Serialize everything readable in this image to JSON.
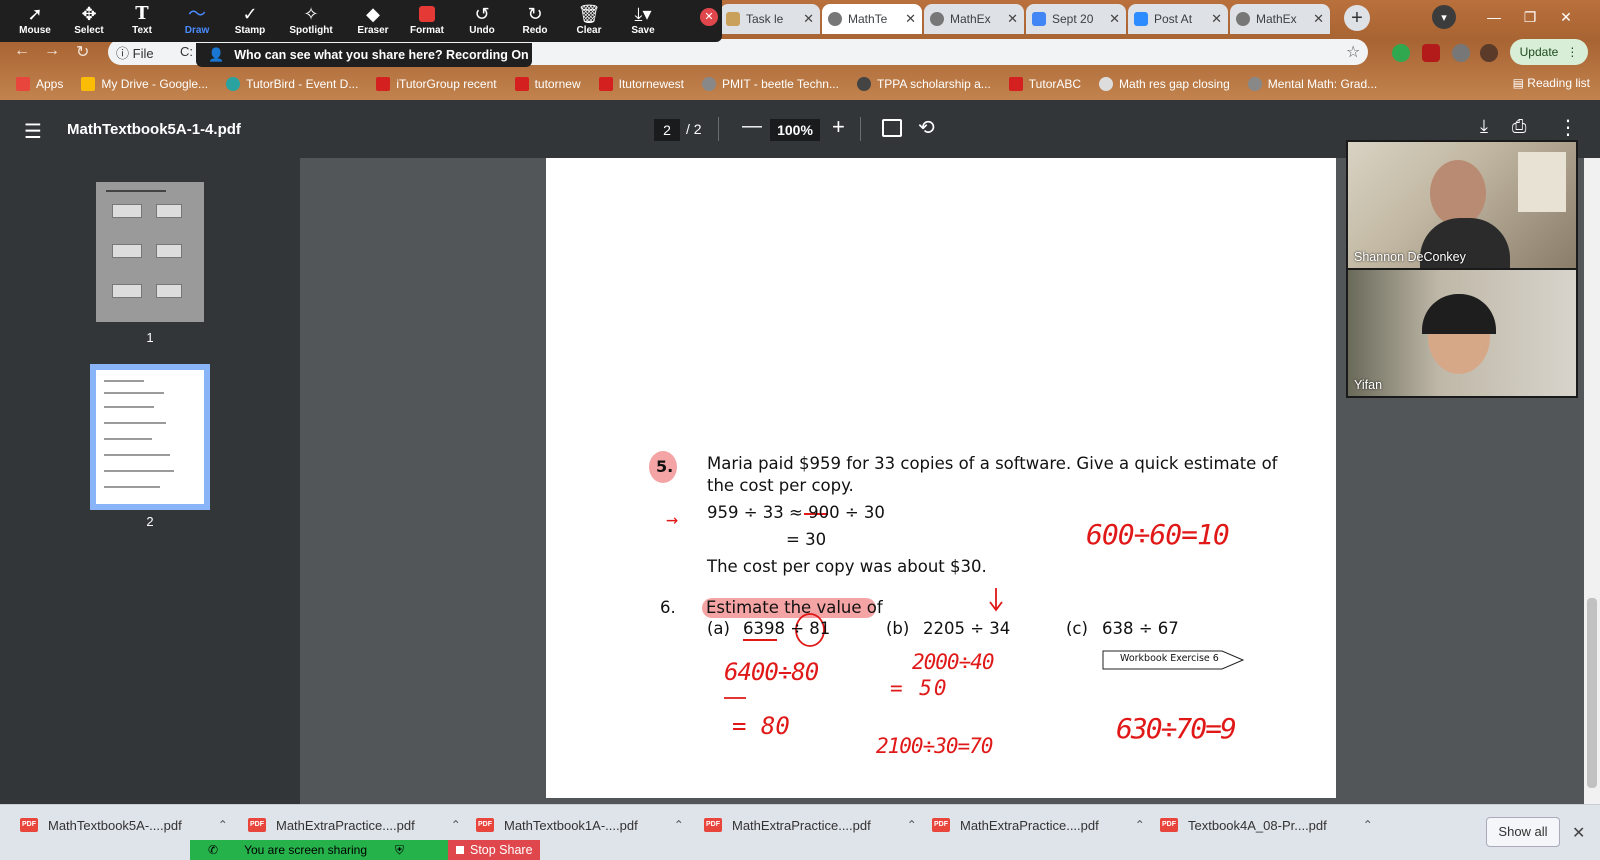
{
  "annotation_toolbar": {
    "tools": [
      {
        "label": "Mouse",
        "icon": "cursor-icon"
      },
      {
        "label": "Select",
        "icon": "move-icon"
      },
      {
        "label": "Text",
        "icon": "text-icon"
      },
      {
        "label": "Draw",
        "icon": "draw-icon"
      },
      {
        "label": "Stamp",
        "icon": "checkmark-icon"
      },
      {
        "label": "Spotlight",
        "icon": "spotlight-icon"
      },
      {
        "label": "Eraser",
        "icon": "eraser-icon"
      },
      {
        "label": "Format",
        "icon": "format-icon"
      },
      {
        "label": "Undo",
        "icon": "undo-icon"
      },
      {
        "label": "Redo",
        "icon": "redo-icon"
      },
      {
        "label": "Clear",
        "icon": "trash-icon"
      },
      {
        "label": "Save",
        "icon": "save-icon"
      }
    ],
    "active_tool": "Draw",
    "share_banner": "Who can see what you share here? Recording On"
  },
  "browser": {
    "tabs": [
      {
        "label": "Task le",
        "active": false
      },
      {
        "label": "MathTe",
        "active": true
      },
      {
        "label": "MathEx",
        "active": false
      },
      {
        "label": "Sept 20",
        "active": false
      },
      {
        "label": "Post At",
        "active": false
      },
      {
        "label": "MathEx",
        "active": false
      }
    ],
    "address": {
      "info": "File",
      "text": "C:"
    },
    "update_label": "Update",
    "bookmarks": [
      "Apps",
      "My Drive - Google...",
      "TutorBird - Event D...",
      "iTutorGroup recent",
      "tutornew",
      "Itutornewest",
      "PMIT - beetle Techn...",
      "TPPA scholarship a...",
      "TutorABC",
      "Math res gap closing",
      "Mental Math: Grad..."
    ],
    "reading_list": "Reading list"
  },
  "pdf_viewer": {
    "title": "MathTextbook5A-1-4.pdf",
    "current_page": "2",
    "total_pages": "/ 2",
    "zoom": "100%",
    "thumbnails": [
      "1",
      "2"
    ]
  },
  "page_content": {
    "q5_number": "5.",
    "q5_text_line1": "Maria paid $959 for 33 copies of a software. Give a quick estimate of",
    "q5_text_line2": "the cost per copy.",
    "q5_calc_line1": "959  ÷  33 ≈ 900 ÷ 30",
    "q5_calc_line2": "= 30",
    "q5_answer": "The cost per copy was about $30.",
    "q6_number": "6.",
    "q6_text": "Estimate the value of",
    "q6_a_label": "(a)",
    "q6_a_expr": "6398 ÷ 81",
    "q6_b_label": "(b)",
    "q6_b_expr": "2205 ÷ 34",
    "q6_c_label": "(c)",
    "q6_c_expr": "638 ÷ 67",
    "workbook_label": "Workbook Exercise 6"
  },
  "handwriting": {
    "arrow": "→",
    "q5_side": "600÷60=10",
    "a_line1": "6400÷80",
    "a_line2": "= 80",
    "b_line1": "2000÷40",
    "b_line2": "= 50",
    "b_alt": "2100÷30=70",
    "c_line": "630÷70=9"
  },
  "participants": [
    {
      "name": "Shannon DeConkey"
    },
    {
      "name": "Yifan"
    }
  ],
  "downloads": {
    "items": [
      "MathTextbook5A-....pdf",
      "MathExtraPractice....pdf",
      "MathTextbook1A-....pdf",
      "MathExtraPractice....pdf",
      "MathExtraPractice....pdf",
      "Textbook4A_08-Pr....pdf"
    ],
    "show_all": "Show all"
  },
  "zoom_share": {
    "sharing_label": "You are screen sharing",
    "stop_label": "Stop Share"
  }
}
